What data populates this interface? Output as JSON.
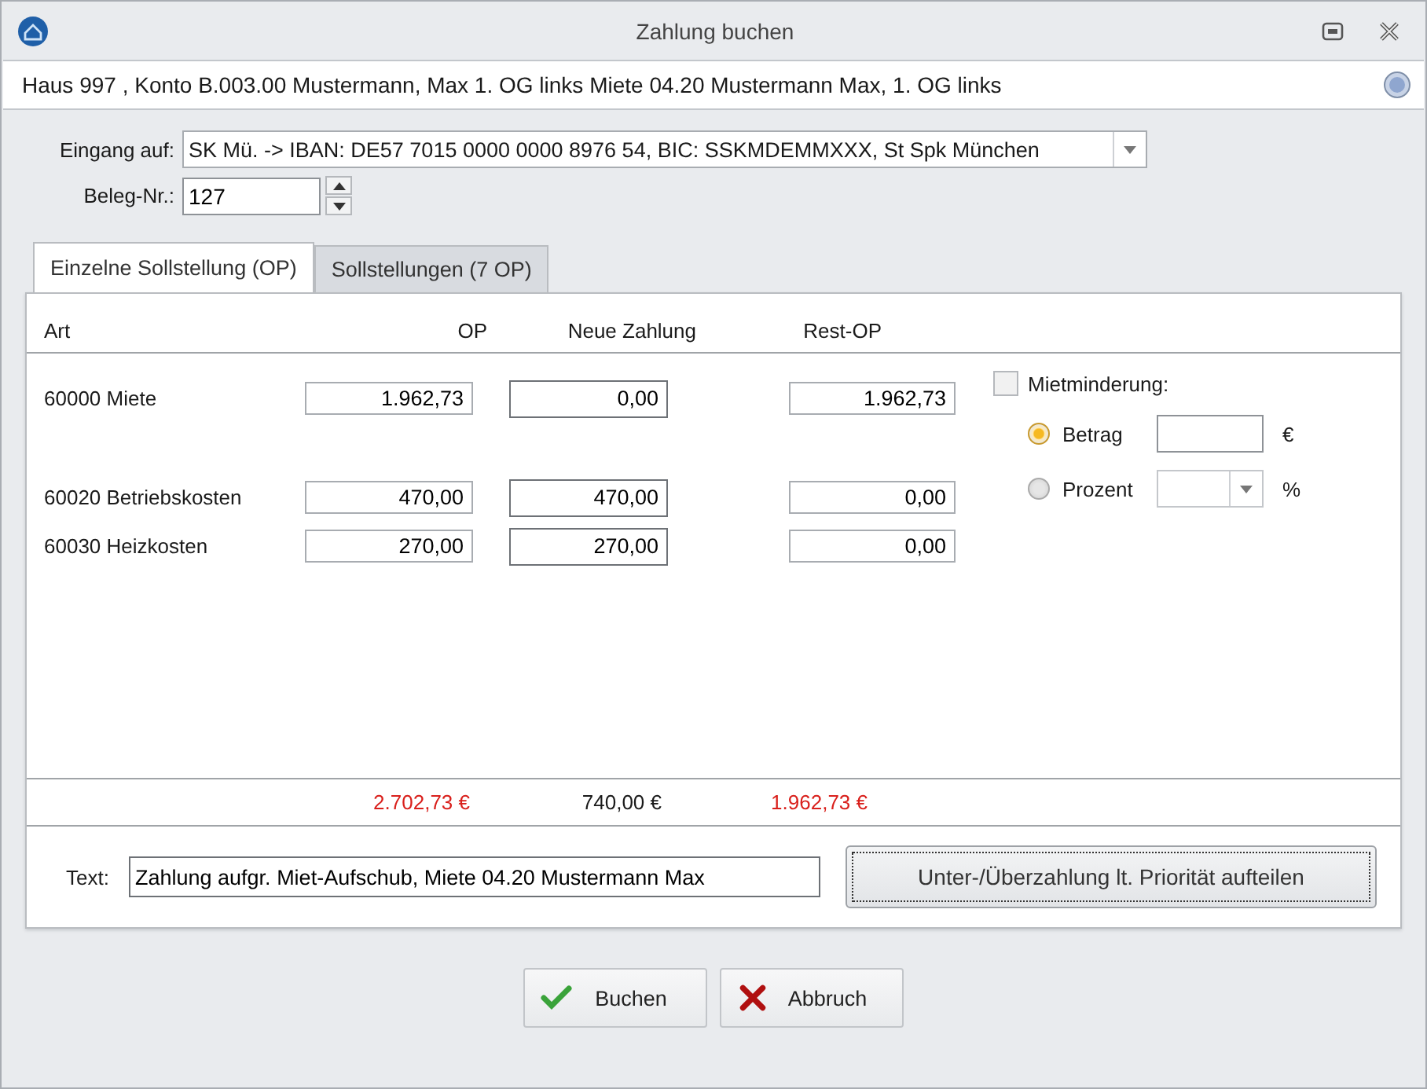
{
  "window": {
    "title": "Zahlung buchen"
  },
  "info_bar": {
    "text": "Haus 997 , Konto B.003.00 Mustermann, Max 1. OG links Miete 04.20 Mustermann Max, 1. OG links"
  },
  "eingang": {
    "label": "Eingang auf:",
    "value": "SK Mü. -> IBAN: DE57 7015 0000 0000 8976 54, BIC: SSKMDEMMXXX, St Spk München"
  },
  "beleg": {
    "label": "Beleg-Nr.:",
    "value": "127"
  },
  "tabs": [
    {
      "label": "Einzelne Sollstellung (OP)",
      "selected": true
    },
    {
      "label": "Sollstellungen (7 OP)",
      "selected": false
    }
  ],
  "table": {
    "columns": [
      "Art",
      "OP",
      "Neue Zahlung",
      "Rest-OP"
    ],
    "rows": [
      {
        "art": "60000 Miete",
        "op": "1.962,73",
        "neue_zahlung": "0,00",
        "rest_op": "1.962,73"
      },
      {
        "art": "60020 Betriebskosten",
        "op": "470,00",
        "neue_zahlung": "470,00",
        "rest_op": "0,00"
      },
      {
        "art": "60030 Heizkosten",
        "op": "270,00",
        "neue_zahlung": "270,00",
        "rest_op": "0,00"
      }
    ],
    "totals": [
      {
        "text": "2.702,73 €",
        "color": "#d9201c"
      },
      {
        "text": "740,00 €",
        "color": "#1a1a1a"
      },
      {
        "text": "1.962,73 €",
        "color": "#d9201c"
      }
    ]
  },
  "mietminderung": {
    "label": "Mietminderung:",
    "checked": false,
    "options": [
      {
        "label": "Betrag",
        "selected": true,
        "kind": "input",
        "unit": "€"
      },
      {
        "label": "Prozent",
        "selected": false,
        "kind": "dropdown",
        "unit": "%"
      }
    ]
  },
  "text_field": {
    "label": "Text:",
    "value": "Zahlung aufgr. Miet-Aufschub, Miete 04.20 Mustermann Max"
  },
  "split_button": "Unter-/Überzahlung lt. Priorität aufteilen",
  "buttons": [
    {
      "label": "Buchen",
      "kind": "ok"
    },
    {
      "label": "Abbruch",
      "kind": "cancel"
    }
  ]
}
